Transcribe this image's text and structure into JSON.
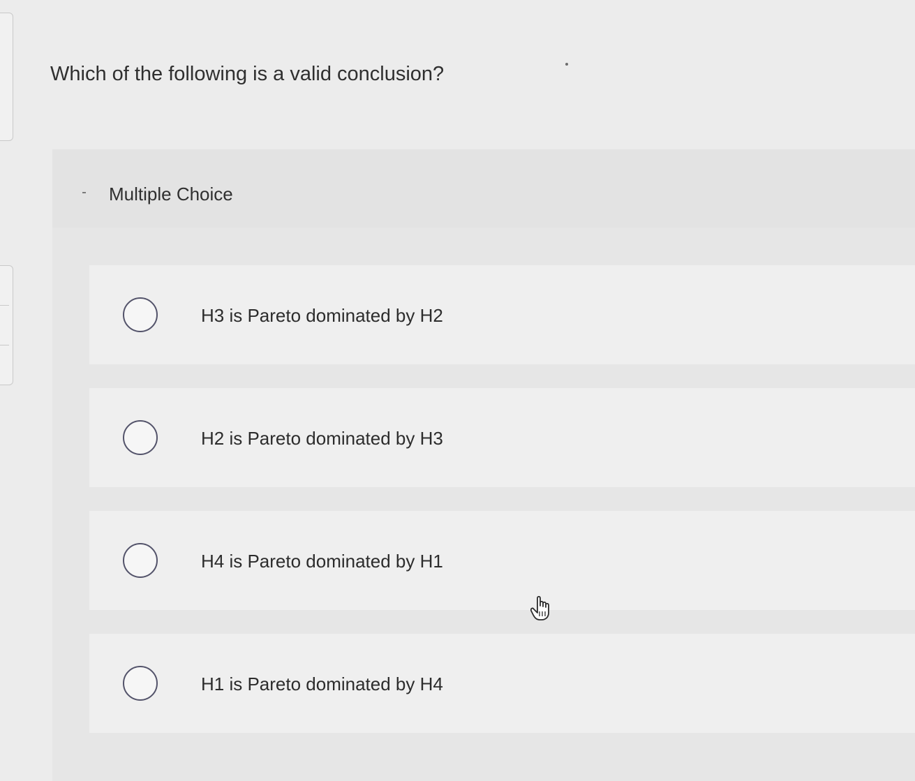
{
  "question": {
    "text": "Which of the following is a valid conclusion?"
  },
  "section": {
    "title": "Multiple Choice"
  },
  "choices": [
    {
      "label": "H3 is Pareto dominated by H2",
      "selected": false
    },
    {
      "label": "H2 is Pareto dominated by H3",
      "selected": false
    },
    {
      "label": "H4 is Pareto dominated by H1",
      "selected": false
    },
    {
      "label": "H1 is Pareto dominated by H4",
      "selected": false
    }
  ],
  "icons": {
    "radio": "radio-unchecked-icon",
    "cursor": "hand-pointer-icon"
  },
  "colors": {
    "background": "#ececec",
    "panel": "#e6e6e6",
    "choice_background": "#efefef",
    "radio_border": "#53536a",
    "text": "#2c2c2c"
  }
}
